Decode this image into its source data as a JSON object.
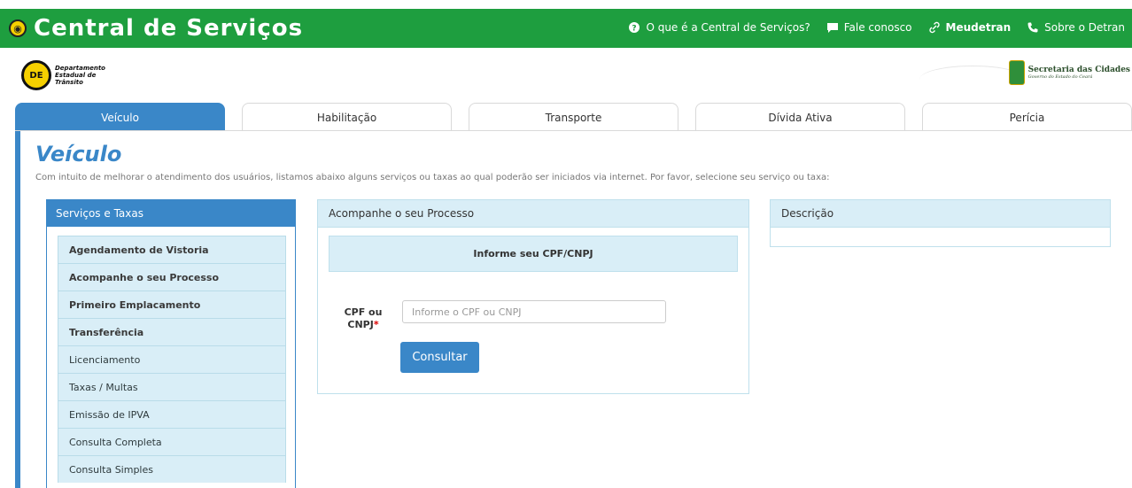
{
  "app": {
    "brand_title": "Central de Serviços"
  },
  "topnav": [
    {
      "label": "O que é a Central de Serviços?",
      "icon": "question-circle-icon"
    },
    {
      "label": "Fale conosco",
      "icon": "chat-bubble-icon"
    },
    {
      "label": "Meudetran",
      "icon": "link-icon"
    },
    {
      "label": "Sobre o Detran",
      "icon": "phone-icon"
    }
  ],
  "logos": {
    "detran_line1": "Departamento",
    "detran_line2": "Estadual de",
    "detran_line3": "Trânsito",
    "secretaria_line1": "Secretaria das Cidades",
    "secretaria_line2": "Governo do Estado do Ceará"
  },
  "tabs": [
    "Veículo",
    "Habilitação",
    "Transporte",
    "Dívida Ativa",
    "Perícia"
  ],
  "main": {
    "title": "Veículo",
    "intro": "Com intuito de melhorar o atendimento dos usuários, listamos abaixo alguns serviços ou taxas ao qual poderão ser iniciados via internet. Por favor, selecione seu serviço ou taxa:"
  },
  "services": {
    "header": "Serviços e Taxas",
    "items": [
      "Agendamento de Vistoria",
      "Acompanhe o seu Processo",
      "Primeiro Emplacamento",
      "Transferência",
      "Licenciamento",
      "Taxas / Multas",
      "Emissão de IPVA",
      "Consulta Completa",
      "Consulta Simples"
    ]
  },
  "process": {
    "header": "Acompanhe o seu Processo",
    "inform_label": "Informe seu CPF/CNPJ",
    "cpf_label_line1": "CPF ou",
    "cpf_label_line2": "CNPJ",
    "required_mark": "*",
    "cpf_placeholder": "Informe o CPF ou CNPJ",
    "cpf_value": "",
    "button": "Consultar"
  },
  "description": {
    "header": "Descrição"
  },
  "colors": {
    "topbar": "#1e9e3f",
    "accent": "#3a87c8",
    "panel_light": "#d9eef7"
  }
}
